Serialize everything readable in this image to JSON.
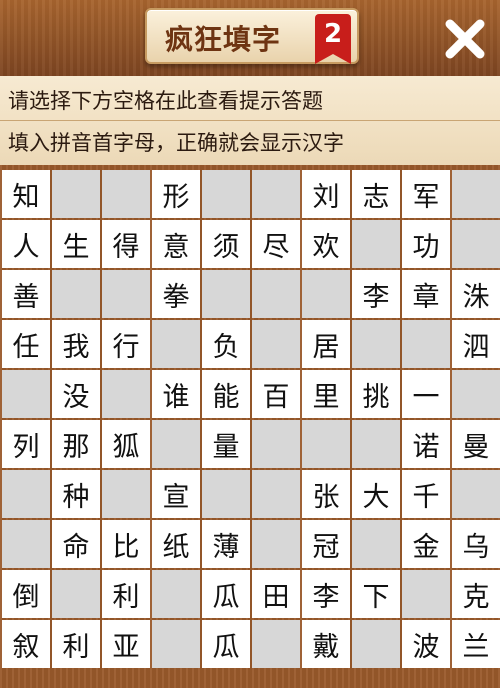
{
  "header": {
    "title": "疯狂填字",
    "level_badge": "2",
    "close_icon": "close-icon"
  },
  "hints": {
    "line1": "请选择下方空格在此查看提示答题",
    "line2": "填入拼音首字母，正确就会显示汉字"
  },
  "colors": {
    "cell_filled": "#ffffff",
    "cell_blank": "#d7d7d7",
    "board_wood": "#9a5a2b",
    "badge": "#c81e1b"
  },
  "grid": [
    [
      "知",
      "",
      "",
      "形",
      "",
      "",
      "刘",
      "志",
      "军",
      ""
    ],
    [
      "人",
      "生",
      "得",
      "意",
      "须",
      "尽",
      "欢",
      "",
      "功",
      ""
    ],
    [
      "善",
      "",
      "",
      "拳",
      "",
      "",
      "",
      "李",
      "章",
      "洙"
    ],
    [
      "任",
      "我",
      "行",
      "",
      "负",
      "",
      "居",
      "",
      "",
      "泗"
    ],
    [
      "",
      "没",
      "",
      "谁",
      "能",
      "百",
      "里",
      "挑",
      "一",
      ""
    ],
    [
      "列",
      "那",
      "狐",
      "",
      "量",
      "",
      "",
      "",
      "诺",
      "曼"
    ],
    [
      "",
      "种",
      "",
      "宣",
      "",
      "",
      "张",
      "大",
      "千",
      ""
    ],
    [
      "",
      "命",
      "比",
      "纸",
      "薄",
      "",
      "冠",
      "",
      "金",
      "乌"
    ],
    [
      "倒",
      "",
      "利",
      "",
      "瓜",
      "田",
      "李",
      "下",
      "",
      "克"
    ],
    [
      "叙",
      "利",
      "亚",
      "",
      "瓜",
      "",
      "戴",
      "",
      "波",
      "兰"
    ]
  ],
  "blank_cells": [
    [
      0,
      1
    ],
    [
      0,
      2
    ],
    [
      0,
      4
    ],
    [
      0,
      5
    ],
    [
      0,
      9
    ],
    [
      1,
      7
    ],
    [
      1,
      9
    ],
    [
      2,
      1
    ],
    [
      2,
      2
    ],
    [
      2,
      4
    ],
    [
      2,
      5
    ],
    [
      2,
      6
    ],
    [
      3,
      3
    ],
    [
      3,
      5
    ],
    [
      3,
      7
    ],
    [
      3,
      8
    ],
    [
      4,
      0
    ],
    [
      4,
      2
    ],
    [
      4,
      9
    ],
    [
      5,
      3
    ],
    [
      5,
      5
    ],
    [
      5,
      6
    ],
    [
      5,
      7
    ],
    [
      6,
      0
    ],
    [
      6,
      2
    ],
    [
      6,
      4
    ],
    [
      6,
      5
    ],
    [
      6,
      9
    ],
    [
      7,
      0
    ],
    [
      7,
      5
    ],
    [
      7,
      7
    ],
    [
      8,
      1
    ],
    [
      8,
      3
    ],
    [
      8,
      8
    ],
    [
      9,
      3
    ],
    [
      9,
      5
    ],
    [
      9,
      7
    ]
  ]
}
